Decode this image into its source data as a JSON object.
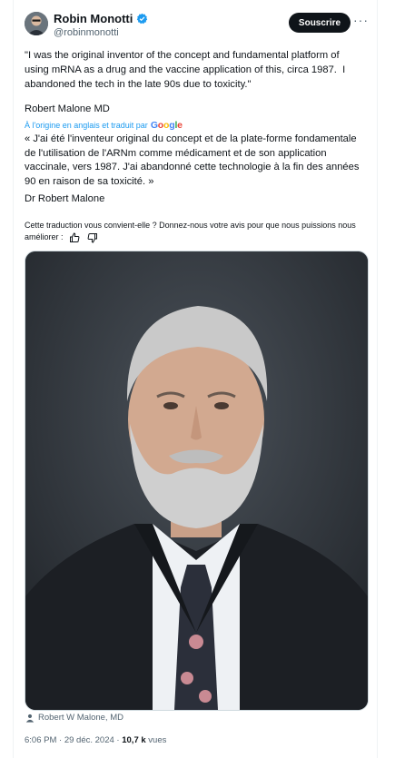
{
  "author": {
    "display_name": "Robin Monotti",
    "handle": "@robinmonotti",
    "verified": true
  },
  "actions": {
    "subscribe_label": "Souscrire",
    "more_label": "···"
  },
  "tweet": {
    "text": "\"I was the original inventor of the concept and fundamental platform of using mRNA as a drug and the vaccine application of this, circa 1987.  I abandoned the tech in the late 90s due to toxicity.\"",
    "signature": "Robert Malone MD"
  },
  "translation": {
    "attribution_prefix": "À l'origine en anglais et traduit par",
    "google_letters": [
      "G",
      "o",
      "o",
      "g",
      "l",
      "e"
    ],
    "text": "« J'ai été l'inventeur original du concept et de la plate-forme fondamentale de l'utilisation de l'ARNm comme médicament et de son application vaccinale, vers 1987. J'ai abandonné cette technologie à la fin des années 90 en raison de sa toxicité. »",
    "signature": "Dr Robert Malone",
    "feedback_prompt": "Cette traduction vous convient-elle ? Donnez-nous votre avis pour que nous puissions nous améliorer :"
  },
  "media": {
    "caption": "Robert W Malone, MD"
  },
  "meta": {
    "time": "6:06 PM",
    "separator": " · ",
    "date": "29 déc. 2024",
    "views_count": "10,7 k",
    "views_label": " vues"
  },
  "colors": {
    "accent": "#1d9bf0",
    "text": "#0f1419",
    "muted": "#536471",
    "button_bg": "#0f1419"
  }
}
